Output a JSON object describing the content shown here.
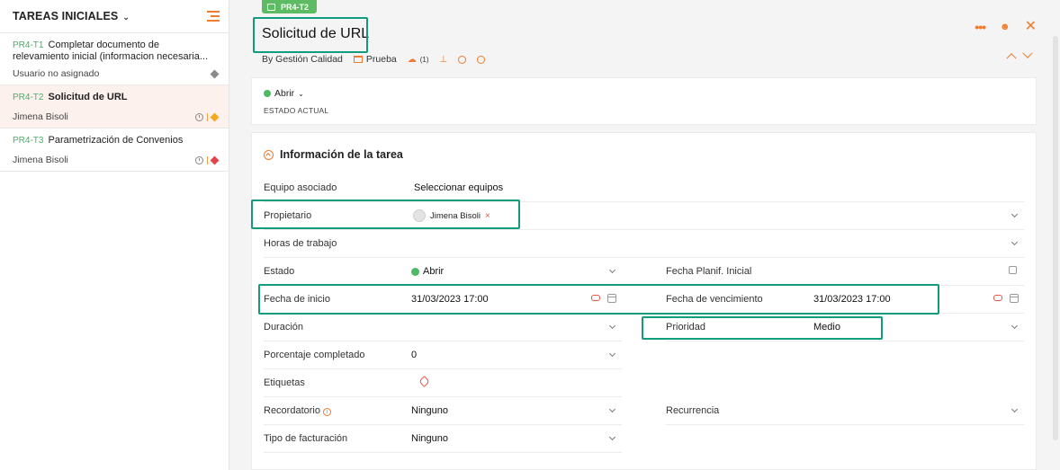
{
  "sidebar": {
    "title": "TAREAS INICIALES",
    "tasks": [
      {
        "id": "PR4-T1",
        "name": "Completar documento de relevamiento inicial (informacion necesaria...",
        "assignee": "Usuario no asignado",
        "priority_color": "#8a8a8a"
      },
      {
        "id": "PR4-T2",
        "name": "Solicitud de URL",
        "assignee": "Jimena Bisoli",
        "priority_color": "#f5a623"
      },
      {
        "id": "PR4-T3",
        "name": "Parametrización de Convenios",
        "assignee": "Jimena Bisoli",
        "priority_color": "#e0464a"
      }
    ]
  },
  "header": {
    "badge": "PR4-T2",
    "title": "Solicitud de URL",
    "by": "By Gestión Calidad",
    "project": "Prueba",
    "comments_count": "(1)"
  },
  "status": {
    "value": "Abrir",
    "label": "ESTADO ACTUAL"
  },
  "section": {
    "title": "Información de la tarea",
    "fields": {
      "equipo": {
        "label": "Equipo asociado",
        "value": "Seleccionar equipos"
      },
      "propietario": {
        "label": "Propietario",
        "value": "Jimena Bisoli"
      },
      "horas": {
        "label": "Horas de trabajo"
      },
      "estado": {
        "label": "Estado",
        "value": "Abrir"
      },
      "planif": {
        "label": "Fecha Planif. Inicial"
      },
      "inicio": {
        "label": "Fecha de inicio",
        "value": "31/03/2023 17:00"
      },
      "vencimiento": {
        "label": "Fecha de vencimiento",
        "value": "31/03/2023 17:00"
      },
      "duracion": {
        "label": "Duración"
      },
      "prioridad": {
        "label": "Prioridad",
        "value": "Medio"
      },
      "porcentaje": {
        "label": "Porcentaje completado",
        "value": "0"
      },
      "etiquetas": {
        "label": "Etiquetas"
      },
      "recordatorio": {
        "label": "Recordatorio",
        "value": "Ninguno"
      },
      "recurrencia": {
        "label": "Recurrencia"
      },
      "facturacion": {
        "label": "Tipo de facturación",
        "value": "Ninguno"
      }
    }
  },
  "colors": {
    "accent": "#f07b2e",
    "highlight": "#129c7d",
    "open_status": "#4cb963",
    "id_green": "#4cae6a"
  },
  "icons": [
    "chevron-down-icon",
    "list-icon",
    "clock-icon",
    "calendar-icon",
    "comment-icon",
    "attachment-icon",
    "timer-icon",
    "info-icon",
    "more-icon",
    "share-icon",
    "close-icon",
    "chevron-up-icon",
    "collapse-icon",
    "eraser-icon",
    "tag-icon",
    "warning-icon"
  ]
}
